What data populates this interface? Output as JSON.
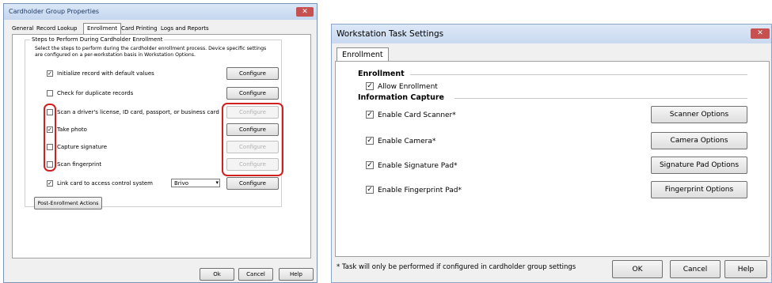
{
  "left_window": {
    "title": "Cardholder Group Properties",
    "close_icon": "close-icon",
    "tabs": [
      "General",
      "Record Lookup",
      "Enrollment",
      "Card Printing",
      "Logs and Reports"
    ],
    "active_tab": "Enrollment",
    "group_title": "Steps to Perform During Cardholder Enrollment",
    "description_line1": "Select the steps to perform during the cardholder enrollment process. Device specific settings",
    "description_line2": "are configured on a per-workstation basis in Workstation Options.",
    "steps": [
      {
        "label": "Initialize record with default values",
        "checked": true,
        "button": "Configure",
        "enabled": true
      },
      {
        "label": "Check for duplicate records",
        "checked": false,
        "button": "Configure",
        "enabled": true
      },
      {
        "label": "Scan a driver's license, ID card, passport, or business card",
        "checked": false,
        "button": "Configure",
        "enabled": false
      },
      {
        "label": "Take photo",
        "checked": true,
        "button": "Configure",
        "enabled": true
      },
      {
        "label": "Capture signature",
        "checked": false,
        "button": "Configure",
        "enabled": false
      },
      {
        "label": "Scan fingerprint",
        "checked": false,
        "button": "Configure",
        "enabled": false
      }
    ],
    "link_card": {
      "label": "Link card to access control system",
      "checked": true,
      "select_value": "Brivo",
      "button": "Configure"
    },
    "post_enrollment_button": "Post-Enrollment Actions",
    "ok_button": "Ok",
    "cancel_button": "Cancel",
    "help_button": "Help",
    "highlight_color": "#d02020"
  },
  "right_window": {
    "title": "Workstation Task Settings",
    "close_icon": "close-icon",
    "tab": "Enrollment",
    "enrollment_heading": "Enrollment",
    "allow_enrollment": {
      "label": "Allow Enrollment",
      "checked": true
    },
    "info_capture_heading": "Information Capture",
    "capture_items": [
      {
        "label": "Enable Card Scanner*",
        "checked": true,
        "button": "Scanner Options"
      },
      {
        "label": "Enable Camera*",
        "checked": true,
        "button": "Camera Options"
      },
      {
        "label": "Enable Signature Pad*",
        "checked": true,
        "button": "Signature Pad Options"
      },
      {
        "label": "Enable Fingerprint Pad*",
        "checked": true,
        "button": "Fingerprint Options"
      }
    ],
    "footnote": "* Task will only be performed if configured in cardholder group settings",
    "ok_button": "OK",
    "cancel_button": "Cancel",
    "help_button": "Help"
  }
}
